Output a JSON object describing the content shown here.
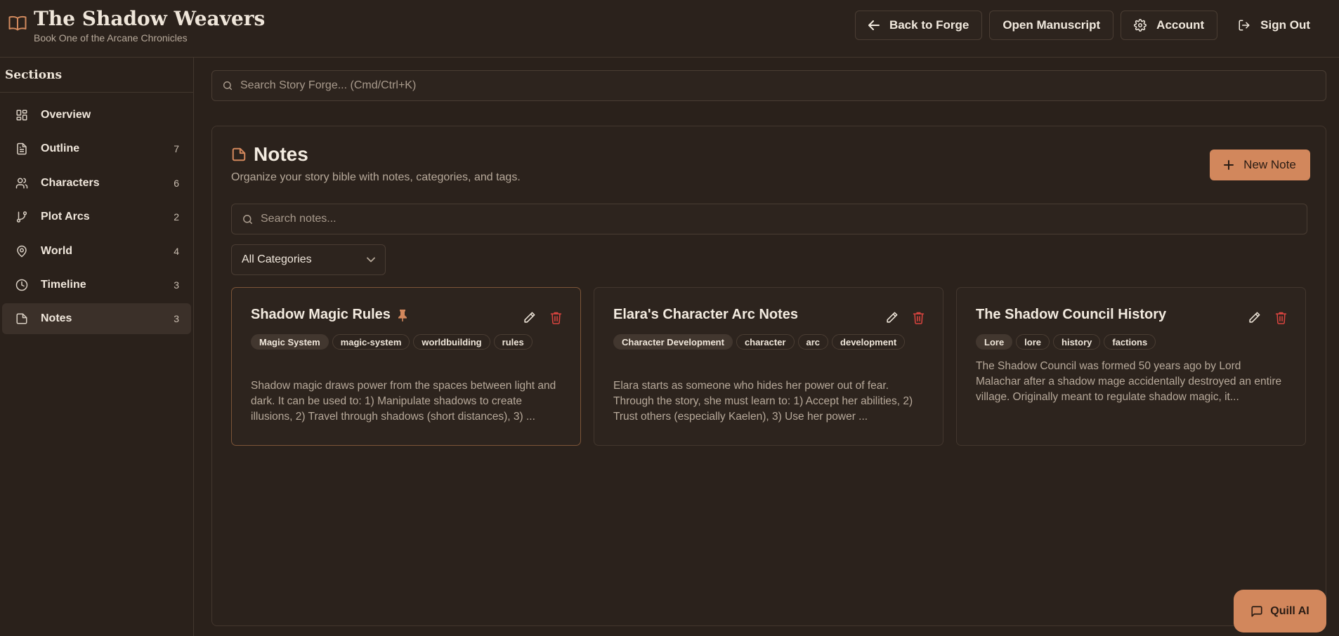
{
  "app": {
    "title": "The Shadow Weavers",
    "subtitle": "Book One of the Arcane Chronicles"
  },
  "header": {
    "back_label": "Back to Forge",
    "manuscript_label": "Open Manuscript",
    "account_label": "Account",
    "signout_label": "Sign Out"
  },
  "sidebar": {
    "heading": "Sections",
    "items": [
      {
        "label": "Overview",
        "count": "",
        "icon": "grid-icon"
      },
      {
        "label": "Outline",
        "count": "7",
        "icon": "document-icon"
      },
      {
        "label": "Characters",
        "count": "6",
        "icon": "users-icon"
      },
      {
        "label": "Plot Arcs",
        "count": "2",
        "icon": "branch-icon"
      },
      {
        "label": "World",
        "count": "4",
        "icon": "map-pin-icon"
      },
      {
        "label": "Timeline",
        "count": "3",
        "icon": "clock-icon"
      },
      {
        "label": "Notes",
        "count": "3",
        "icon": "note-icon",
        "active": true
      }
    ]
  },
  "search": {
    "placeholder": "Search Story Forge... (Cmd/Ctrl+K)"
  },
  "notes": {
    "title": "Notes",
    "subtitle": "Organize your story bible with notes, categories, and tags.",
    "new_note_label": "New Note",
    "search_placeholder": "Search notes...",
    "category_filter": "All Categories",
    "cards": [
      {
        "title": "Shadow Magic Rules",
        "pinned": true,
        "category": "Magic System",
        "tags": [
          "magic-system",
          "worldbuilding",
          "rules"
        ],
        "body": "Shadow magic draws power from the spaces between light and dark. It can be used to: 1) Manipulate shadows to create illusions, 2) Travel through shadows (short distances), 3) ..."
      },
      {
        "title": "Elara's Character Arc Notes",
        "pinned": false,
        "category": "Character Development",
        "tags": [
          "character",
          "arc",
          "development"
        ],
        "body": "Elara starts as someone who hides her power out of fear. Through the story, she must learn to: 1) Accept her abilities, 2) Trust others (especially Kaelen), 3) Use her power ..."
      },
      {
        "title": "The Shadow Council History",
        "pinned": false,
        "category": "Lore",
        "tags": [
          "lore",
          "history",
          "factions"
        ],
        "body": "The Shadow Council was formed 50 years ago by Lord Malachar after a shadow mage accidentally destroyed an entire village. Originally meant to regulate shadow magic, it..."
      }
    ]
  },
  "assistant": {
    "label": "Quill AI"
  },
  "colors": {
    "background": "#2a211b",
    "accent": "#d2875c",
    "delete": "#d9443f",
    "pin": "#d2875c"
  }
}
